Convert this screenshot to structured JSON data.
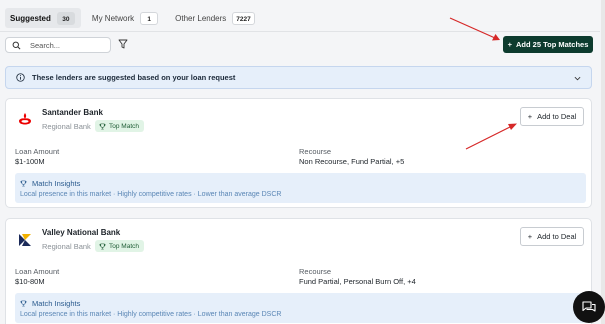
{
  "tabs": [
    {
      "label": "Suggested",
      "count": "30"
    },
    {
      "label": "My Network",
      "count": "1"
    },
    {
      "label": "Other Lenders",
      "count": "7227"
    }
  ],
  "search": {
    "placeholder": "Search..."
  },
  "add_top_matches_label": "Add 25 Top Matches",
  "banner_text": "These lenders are suggested based on your loan request",
  "lenders": [
    {
      "name": "Santander Bank",
      "type": "Regional Bank",
      "badge": "Top Match",
      "add_label": "Add to Deal",
      "loan_amount_label": "Loan Amount",
      "loan_amount": "$1-100M",
      "recourse_label": "Recourse",
      "recourse": "Non Recourse, Fund Partial, +5",
      "insights_title": "Match Insights",
      "insights_detail": "Local presence in this market · Highly competitive rates · Lower than average DSCR",
      "logo": "santander-flame-icon",
      "logo_color": "#ec0000"
    },
    {
      "name": "Valley National Bank",
      "type": "Regional Bank",
      "badge": "Top Match",
      "add_label": "Add to Deal",
      "loan_amount_label": "Loan Amount",
      "loan_amount": "$10-80M",
      "recourse_label": "Recourse",
      "recourse": "Fund Partial, Personal Burn Off, +4",
      "insights_title": "Match Insights",
      "insights_detail": "Local presence in this market · Highly competitive rates · Lower than average DSCR",
      "logo": "valley-chevron-icon",
      "logo_color": "#f2b100"
    }
  ],
  "colors": {
    "primary_button": "#0d3b2e",
    "banner_bg": "#e6effa",
    "top_match_bg": "#e1f4e6",
    "annotation_arrow": "#d62828"
  }
}
